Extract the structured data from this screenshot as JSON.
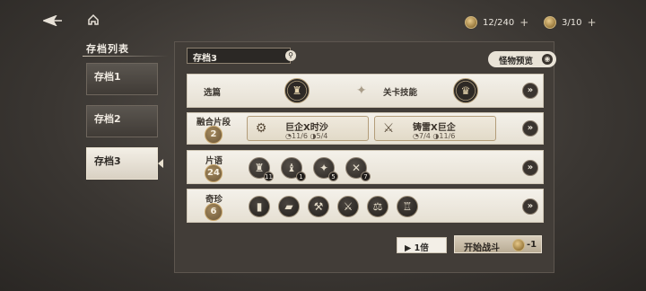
{
  "topbar": {
    "back_icon": "back-arrow-icon",
    "home_icon": "home-icon",
    "resource1": {
      "value": "12/240",
      "plus": "+"
    },
    "resource2": {
      "value": "3/10",
      "plus": "+"
    }
  },
  "sidebar": {
    "title": "存档列表",
    "slots": [
      {
        "label": "存档1"
      },
      {
        "label": "存档2"
      },
      {
        "label": "存档3"
      }
    ]
  },
  "panel": {
    "header_title": "存档3",
    "preview_label": "怪物预览",
    "rows": {
      "chapter": {
        "label": "选篇",
        "skill_label": "关卡技能"
      },
      "fusion": {
        "label": "融合片段",
        "count": "2",
        "cards": [
          {
            "title": "巨企X时沙",
            "stat1": "11/6",
            "stat2": "5/4"
          },
          {
            "title": "铸雷X巨企",
            "stat1": "7/4",
            "stat2": "11/6"
          }
        ]
      },
      "phrase": {
        "label": "片语",
        "count": "24",
        "gems": [
          {
            "count": "11"
          },
          {
            "count": "1"
          },
          {
            "count": "5"
          },
          {
            "count": "7"
          }
        ]
      },
      "treasure": {
        "label": "奇珍",
        "count": "6",
        "relic_count": 6
      }
    },
    "speed_label": "1倍",
    "start_label": "开始战斗",
    "start_cost": "-1"
  },
  "colors": {
    "panel_bg": "#423d38",
    "row_bg": "#f4f1ea",
    "accent_gold": "#caa96f"
  }
}
